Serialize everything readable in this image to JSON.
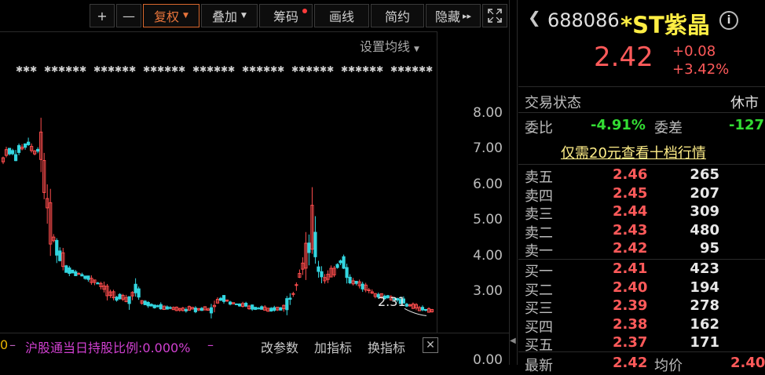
{
  "toolbar": {
    "plus": "+",
    "minus": "—",
    "fuquan": "复权",
    "diejia": "叠加",
    "chouma": "筹码",
    "huaxian": "画线",
    "jianyue": "简约",
    "yincang": "隐藏",
    "more_arrows": "▸▸"
  },
  "chart": {
    "setting_ma": "设置均线",
    "current_label": "2.31",
    "bottom_left_number": "0",
    "hold_ratio": "沪股通当日持股比例:0.000%",
    "gai_canshu": "改参数",
    "jia_zhibiao": "加指标",
    "huan_zhibiao": "换指标",
    "axis": [
      "8.00",
      "7.00",
      "6.00",
      "5.00",
      "4.00",
      "3.00"
    ],
    "axis_bottom": "0.00"
  },
  "chart_data": {
    "type": "candlestick",
    "yaxis_ticks": [
      8.0,
      7.0,
      6.0,
      5.0,
      4.0,
      3.0
    ],
    "ylim": [
      2.0,
      8.5
    ],
    "price_path": [
      6.7,
      6.9,
      6.8,
      7.0,
      7.1,
      6.9,
      7.0,
      5.4,
      4.4,
      4.0,
      3.6,
      3.5,
      3.45,
      3.4,
      3.3,
      3.2,
      3.1,
      2.9,
      2.8,
      2.85,
      2.7,
      3.0,
      2.7,
      2.6,
      2.55,
      2.55,
      2.5,
      2.5,
      2.48,
      2.45,
      2.5,
      2.45,
      2.5,
      2.45,
      2.7,
      2.75,
      2.65,
      2.6,
      2.6,
      2.55,
      2.5,
      2.5,
      2.45,
      2.45,
      2.5,
      2.6,
      2.9,
      3.4,
      3.8,
      4.7,
      3.6,
      3.3,
      3.5,
      3.7,
      3.9,
      3.3,
      3.2,
      3.1,
      3.0,
      2.9,
      2.85,
      2.8,
      2.75,
      2.7,
      2.6,
      2.55,
      2.5,
      2.45,
      2.42
    ],
    "annotation_low": 2.31
  },
  "quote": {
    "code": "688086",
    "name": "*ST紫晶",
    "price": "2.42",
    "change": "+0.08",
    "change_pct": "+3.42%",
    "trade_status_label": "交易状态",
    "trade_status_value": "休市",
    "weibi_label": "委比",
    "weibi_value": "-4.91%",
    "weicha_label": "委差",
    "weicha_value": "-127",
    "promo": "仅需20元查看十档行情",
    "asks": [
      {
        "label": "卖五",
        "price": "2.46",
        "vol": "265"
      },
      {
        "label": "卖四",
        "price": "2.45",
        "vol": "207"
      },
      {
        "label": "卖三",
        "price": "2.44",
        "vol": "309"
      },
      {
        "label": "卖二",
        "price": "2.43",
        "vol": "480"
      },
      {
        "label": "卖一",
        "price": "2.42",
        "vol": "95"
      }
    ],
    "bids": [
      {
        "label": "买一",
        "price": "2.41",
        "vol": "423"
      },
      {
        "label": "买二",
        "price": "2.40",
        "vol": "194"
      },
      {
        "label": "买三",
        "price": "2.39",
        "vol": "278"
      },
      {
        "label": "买四",
        "price": "2.38",
        "vol": "162"
      },
      {
        "label": "买五",
        "price": "2.37",
        "vol": "171"
      }
    ],
    "bottom_latest_label": "最新",
    "bottom_latest_value": "2.42",
    "bottom_avg_label": "均价",
    "bottom_avg_value": "2.40"
  },
  "colors": {
    "up": "#ff4d4d",
    "down": "#33d6e0",
    "accent": "#e8743b"
  }
}
